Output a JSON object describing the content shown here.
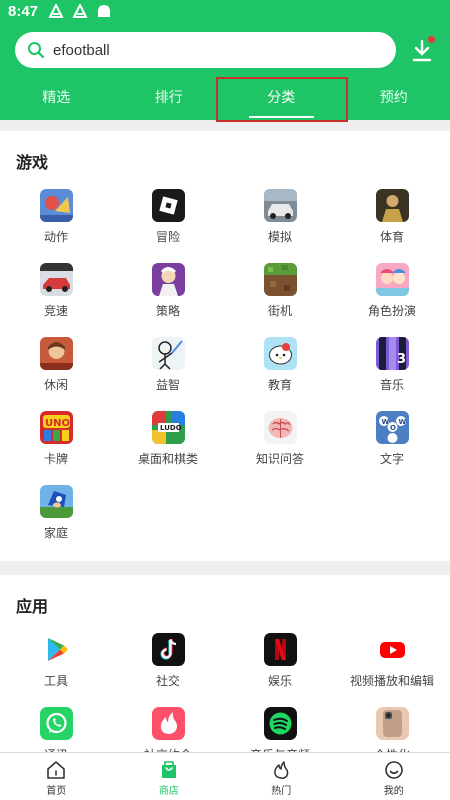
{
  "status": {
    "time": "8:47"
  },
  "search": {
    "value": "efootball"
  },
  "tabs": [
    {
      "label": "精选"
    },
    {
      "label": "排行"
    },
    {
      "label": "分类"
    },
    {
      "label": "预约"
    }
  ],
  "games": {
    "title": "游戏",
    "items": [
      {
        "label": "动作",
        "icon": "action-game-icon"
      },
      {
        "label": "冒险",
        "icon": "roblox-icon"
      },
      {
        "label": "模拟",
        "icon": "car-sim-icon"
      },
      {
        "label": "体育",
        "icon": "sports-icon"
      },
      {
        "label": "竞速",
        "icon": "racing-icon"
      },
      {
        "label": "策略",
        "icon": "strategy-icon"
      },
      {
        "label": "街机",
        "icon": "minecraft-icon"
      },
      {
        "label": "角色扮演",
        "icon": "roleplay-icon"
      },
      {
        "label": "休闲",
        "icon": "casual-icon"
      },
      {
        "label": "益智",
        "icon": "puzzle-icon"
      },
      {
        "label": "教育",
        "icon": "hello-kitty-icon"
      },
      {
        "label": "音乐",
        "icon": "music-game-icon"
      },
      {
        "label": "卡牌",
        "icon": "uno-icon"
      },
      {
        "label": "桌面和棋类",
        "icon": "ludo-icon"
      },
      {
        "label": "知识问答",
        "icon": "brain-icon"
      },
      {
        "label": "文字",
        "icon": "word-game-icon"
      },
      {
        "label": "家庭",
        "icon": "sonic-icon"
      }
    ]
  },
  "apps": {
    "title": "应用",
    "items": [
      {
        "label": "工具",
        "icon": "google-play-icon"
      },
      {
        "label": "社交",
        "icon": "tiktok-icon"
      },
      {
        "label": "娱乐",
        "icon": "netflix-icon"
      },
      {
        "label": "视频播放和编辑",
        "icon": "youtube-icon"
      },
      {
        "label": "通讯",
        "icon": "whatsapp-icon"
      },
      {
        "label": "社交约会",
        "icon": "tinder-icon"
      },
      {
        "label": "音乐与音频",
        "icon": "spotify-icon"
      },
      {
        "label": "个性化",
        "icon": "phone-theme-icon"
      }
    ]
  },
  "nav": [
    {
      "label": "首页"
    },
    {
      "label": "商店"
    },
    {
      "label": "热门"
    },
    {
      "label": "我的"
    }
  ],
  "colors": {
    "brand": "#1fc466",
    "highlight": "#c9302c"
  }
}
